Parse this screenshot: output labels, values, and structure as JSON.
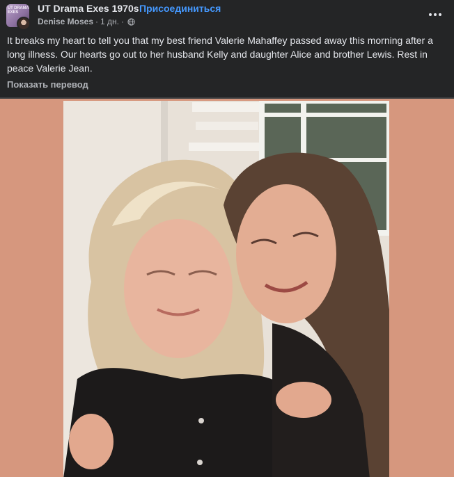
{
  "header": {
    "group_name": "UT Drama Exes 1970s",
    "separator": "·",
    "join_label": "Присоединиться",
    "author": "Denise Moses",
    "meta_separator": "·",
    "time": "1 дн.",
    "meta_separator2": "·",
    "privacy_icon": "globe-icon",
    "group_avatar_text": "UT DRAMA EXES"
  },
  "post": {
    "text": "It breaks my heart to tell you that my best friend Valerie Mahaffey passed away this morning after a long illness. Our hearts go out to her husband Kelly and daughter Alice and brother Lewis. Rest in peace Valerie Jean.",
    "translate_label": "Показать перевод"
  },
  "photo": {
    "subject": "photo-two-women"
  },
  "colors": {
    "background": "#242526",
    "accent_link": "#4599ff",
    "photo_backdrop": "#d6977e"
  }
}
